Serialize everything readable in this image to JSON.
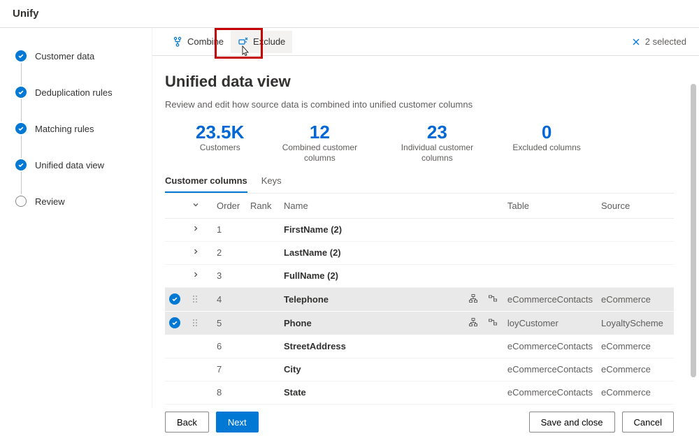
{
  "header": {
    "title": "Unify"
  },
  "steps": [
    {
      "label": "Customer data",
      "state": "done"
    },
    {
      "label": "Deduplication rules",
      "state": "done"
    },
    {
      "label": "Matching rules",
      "state": "done"
    },
    {
      "label": "Unified data view",
      "state": "done"
    },
    {
      "label": "Review",
      "state": "open"
    }
  ],
  "toolbar": {
    "combine": "Combine",
    "exclude": "Exclude",
    "selected_label": "2 selected"
  },
  "page": {
    "title": "Unified data view",
    "subtitle": "Review and edit how source data is combined into unified customer columns"
  },
  "stats": [
    {
      "value": "23.5K",
      "label": "Customers"
    },
    {
      "value": "12",
      "label": "Combined customer columns"
    },
    {
      "value": "23",
      "label": "Individual customer columns"
    },
    {
      "value": "0",
      "label": "Excluded columns"
    }
  ],
  "tabs": {
    "cols": "Customer columns",
    "keys": "Keys"
  },
  "table": {
    "headers": {
      "expand": "",
      "order": "Order",
      "rank": "Rank",
      "name": "Name",
      "table": "Table",
      "source": "Source"
    },
    "rows": [
      {
        "expandable": true,
        "selected": false,
        "order": "1",
        "rank": "",
        "name": "FirstName (2)",
        "table": "",
        "source": ""
      },
      {
        "expandable": true,
        "selected": false,
        "order": "2",
        "rank": "",
        "name": "LastName (2)",
        "table": "",
        "source": ""
      },
      {
        "expandable": true,
        "selected": false,
        "order": "3",
        "rank": "",
        "name": "FullName (2)",
        "table": "",
        "source": ""
      },
      {
        "expandable": false,
        "selected": true,
        "order": "4",
        "rank": "",
        "name": "Telephone",
        "table": "eCommerceContacts",
        "source": "eCommerce",
        "icons": true
      },
      {
        "expandable": false,
        "selected": true,
        "order": "5",
        "rank": "",
        "name": "Phone",
        "table": "loyCustomer",
        "source": "LoyaltyScheme",
        "icons": true
      },
      {
        "expandable": false,
        "selected": false,
        "order": "6",
        "rank": "",
        "name": "StreetAddress",
        "table": "eCommerceContacts",
        "source": "eCommerce"
      },
      {
        "expandable": false,
        "selected": false,
        "order": "7",
        "rank": "",
        "name": "City",
        "table": "eCommerceContacts",
        "source": "eCommerce"
      },
      {
        "expandable": false,
        "selected": false,
        "order": "8",
        "rank": "",
        "name": "State",
        "table": "eCommerceContacts",
        "source": "eCommerce"
      }
    ]
  },
  "footer": {
    "back": "Back",
    "next": "Next",
    "save": "Save and close",
    "cancel": "Cancel"
  }
}
